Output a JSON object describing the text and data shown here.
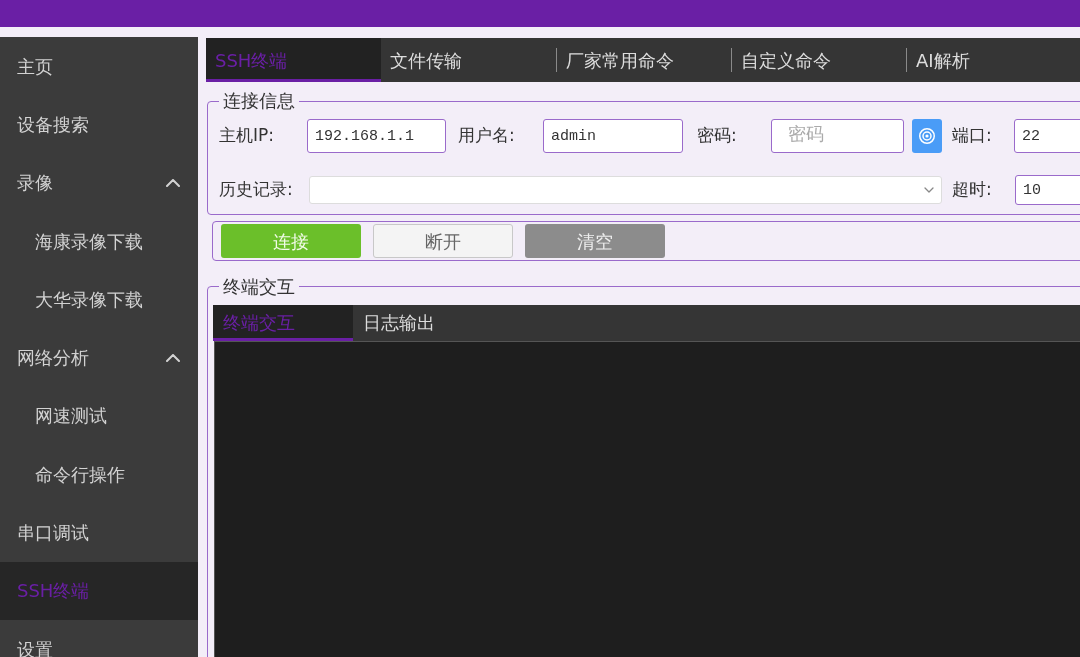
{
  "sidebar": {
    "items": [
      {
        "label": "主页",
        "selected": false
      },
      {
        "label": "设备搜索",
        "selected": false
      },
      {
        "label": "录像",
        "selected": false,
        "expanded": true,
        "children": [
          {
            "label": "海康录像下载",
            "selected": false
          },
          {
            "label": "大华录像下载",
            "selected": false
          }
        ]
      },
      {
        "label": "网络分析",
        "selected": false,
        "expanded": true,
        "children": [
          {
            "label": "网速测试",
            "selected": false
          },
          {
            "label": "命令行操作",
            "selected": false
          }
        ]
      },
      {
        "label": "串口调试",
        "selected": false
      },
      {
        "label": "SSH终端",
        "selected": true
      },
      {
        "label": "设置",
        "selected": false
      }
    ]
  },
  "tabs": [
    {
      "label": "SSH终端",
      "selected": true
    },
    {
      "label": "文件传输",
      "selected": false
    },
    {
      "label": "厂家常用命令",
      "selected": false
    },
    {
      "label": "自定义命令",
      "selected": false
    },
    {
      "label": "AI解析",
      "selected": false
    }
  ],
  "connection": {
    "title": "连接信息",
    "host": {
      "label": "主机IP:",
      "value": "192.168.1.1"
    },
    "username": {
      "label": "用户名:",
      "value": "admin"
    },
    "password": {
      "label": "密码:",
      "placeholder": "密码"
    },
    "port": {
      "label": "端口:",
      "value": "22"
    },
    "history": {
      "label": "历史记录:"
    },
    "timeout": {
      "label": "超时:",
      "value": "10"
    }
  },
  "buttons": [
    {
      "label": "连接",
      "kind": "success"
    },
    {
      "label": "断开",
      "kind": "plain"
    },
    {
      "label": "清空",
      "kind": "gray"
    }
  ],
  "terminal": {
    "title": "终端交互",
    "tabs": [
      {
        "label": "终端交互",
        "selected": true
      },
      {
        "label": "日志输出",
        "selected": false
      }
    ]
  }
}
